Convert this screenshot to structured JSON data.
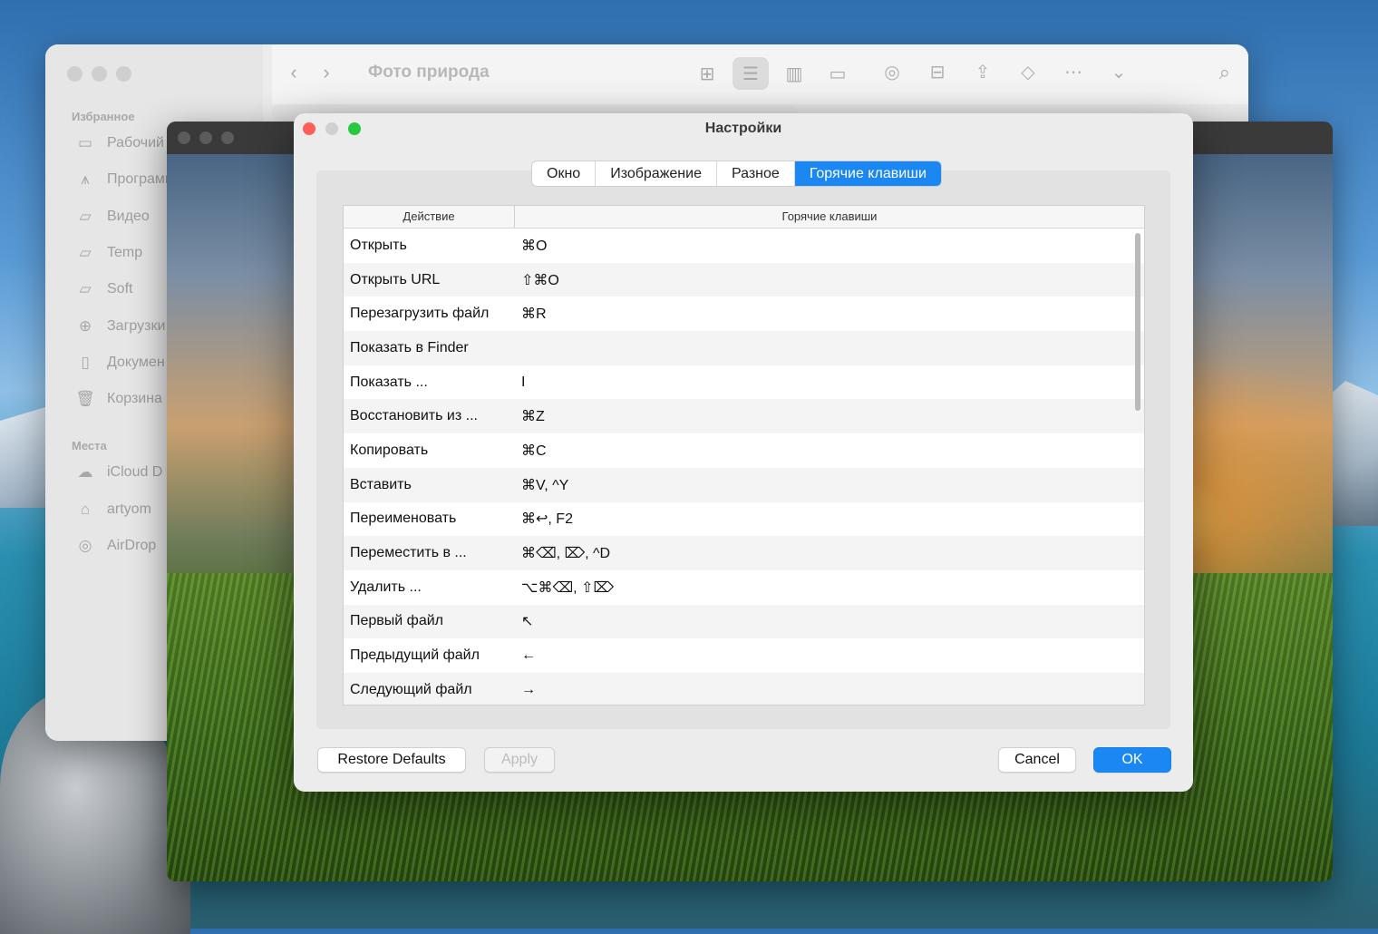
{
  "finder": {
    "title": "Фото природа",
    "sections": {
      "favorites": "Избранное",
      "places": "Места"
    },
    "favorites": [
      {
        "label": "Рабочий",
        "icon": "desktop-icon"
      },
      {
        "label": "Программ",
        "icon": "applications-icon"
      },
      {
        "label": "Видео",
        "icon": "folder-icon"
      },
      {
        "label": "Temp",
        "icon": "folder-icon"
      },
      {
        "label": "Soft",
        "icon": "folder-icon"
      },
      {
        "label": "Загрузки",
        "icon": "download-icon"
      },
      {
        "label": "Докумен",
        "icon": "document-icon"
      },
      {
        "label": "Корзина",
        "icon": "trash-icon"
      }
    ],
    "places": [
      {
        "label": "iCloud D",
        "icon": "cloud-icon"
      },
      {
        "label": "artyom",
        "icon": "home-icon"
      },
      {
        "label": "AirDrop",
        "icon": "airdrop-icon"
      }
    ]
  },
  "dialog": {
    "title": "Настройки",
    "tabs": [
      {
        "label": "Окно",
        "active": false
      },
      {
        "label": "Изображение",
        "active": false
      },
      {
        "label": "Разное",
        "active": false
      },
      {
        "label": "Горячие клавиши",
        "active": true
      }
    ],
    "table": {
      "headers": [
        "Действие",
        "Горячие клавиши"
      ],
      "rows": [
        {
          "action": "Открыть",
          "keys": "⌘O"
        },
        {
          "action": "Открыть URL",
          "keys": "⇧⌘O"
        },
        {
          "action": "Перезагрузить файл",
          "keys": "⌘R"
        },
        {
          "action": "Показать в Finder",
          "keys": ""
        },
        {
          "action": "Показать ...",
          "keys": "I"
        },
        {
          "action": "Восстановить из ...",
          "keys": "⌘Z"
        },
        {
          "action": "Копировать",
          "keys": "⌘C"
        },
        {
          "action": "Вставить",
          "keys": "⌘V, ^Y"
        },
        {
          "action": "Переименовать",
          "keys": "⌘↩, F2"
        },
        {
          "action": "Переместить в ...",
          "keys": "⌘⌫, ⌦, ^D"
        },
        {
          "action": "Удалить ...",
          "keys": "⌥⌘⌫, ⇧⌦"
        },
        {
          "action": "Первый файл",
          "keys": "↖"
        },
        {
          "action": "Предыдущий файл",
          "keys": "←"
        },
        {
          "action": "Следующий файл",
          "keys": "→"
        }
      ]
    },
    "buttons": {
      "restore": "Restore Defaults",
      "apply": "Apply",
      "cancel": "Cancel",
      "ok": "OK"
    }
  },
  "colors": {
    "accent": "#1a87f2",
    "close": "#fe5f57",
    "maximize": "#28c840"
  }
}
